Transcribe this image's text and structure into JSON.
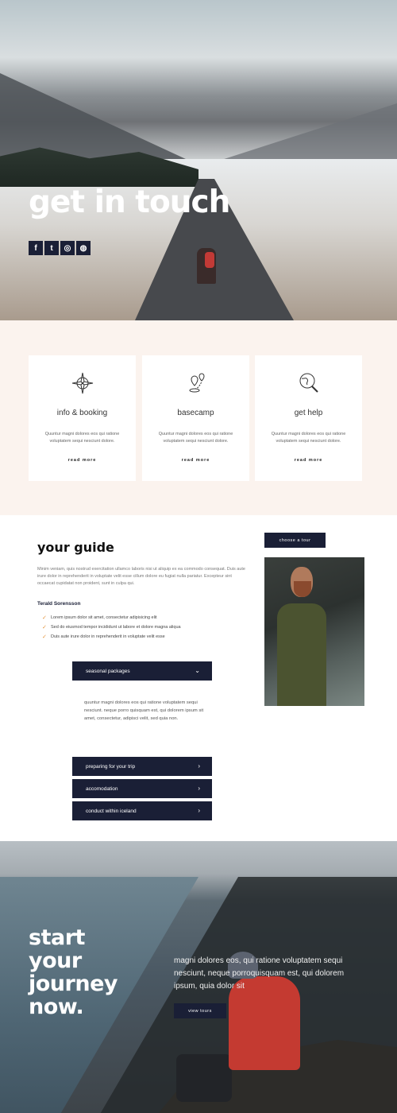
{
  "hero": {
    "title": "get in touch",
    "socials": [
      {
        "icon": "facebook-icon",
        "glyph": "f"
      },
      {
        "icon": "twitter-icon",
        "glyph": "t"
      },
      {
        "icon": "instagram-icon",
        "glyph": "◎"
      },
      {
        "icon": "globe-icon",
        "glyph": "◍"
      }
    ]
  },
  "cards": [
    {
      "icon": "compass-icon",
      "title": "info & booking",
      "desc": "Quuntur magni dolores eos qui ratione voluptatem sequi nesciunt dolore.",
      "link": "read more"
    },
    {
      "icon": "map-pin-icon",
      "title": "basecamp",
      "desc": "Quuntur magni dolores eos qui ratione voluptatem sequi nesciunt dolore.",
      "link": "read more"
    },
    {
      "icon": "globe-search-icon",
      "title": "get help",
      "desc": "Quuntur magni dolores eos qui ratione voluptatem sequi nesciunt dolore.",
      "link": "read more"
    }
  ],
  "guide": {
    "title": "your guide",
    "text": "Minim veniam, quis nostrud exercitation ullamco laboris nisi ut aliquip ex ea commodo consequat. Duis aute irure dolor in reprehenderit in voluptate velit esse cillum dolore eu fugiat nulla pariatur. Excepteur sint occaecat cupidatat non proident, sunt in culpa qui.",
    "name": "Terald Sorensson",
    "checklist": [
      "Lorem ipsum dolor sit amet, consectetur adipisicing elit",
      "Sed do eiusmod tempor incididunt ut labore et dolore magna aliqua",
      "Duis aute irure dolor in reprehenderit in voluptate velit esse"
    ],
    "tour_button": "choose a tour"
  },
  "accordion": {
    "open_label": "seasonal packages",
    "open_body": "quuntur magni dolores eos qui ratione voluptatem sequi nesciunt. neque porro quisquam est, qui dolorem ipsum sit amet, consectetur, adipisci velit, sed quia non.",
    "items": [
      "preparing for your trip",
      "accomodation",
      "conduct within iceland"
    ]
  },
  "footer": {
    "title_lines": [
      "start",
      "your",
      "journey",
      "now."
    ],
    "text": "magni dolores eos, qui ratione voluptatem sequi nesciunt, neque porroquisquam est, qui dolorem ipsum, quia dolor sit",
    "button": "view tours"
  },
  "colors": {
    "navy": "#1a1f36",
    "cream": "#fbf3ee",
    "accent": "#e4943d"
  }
}
